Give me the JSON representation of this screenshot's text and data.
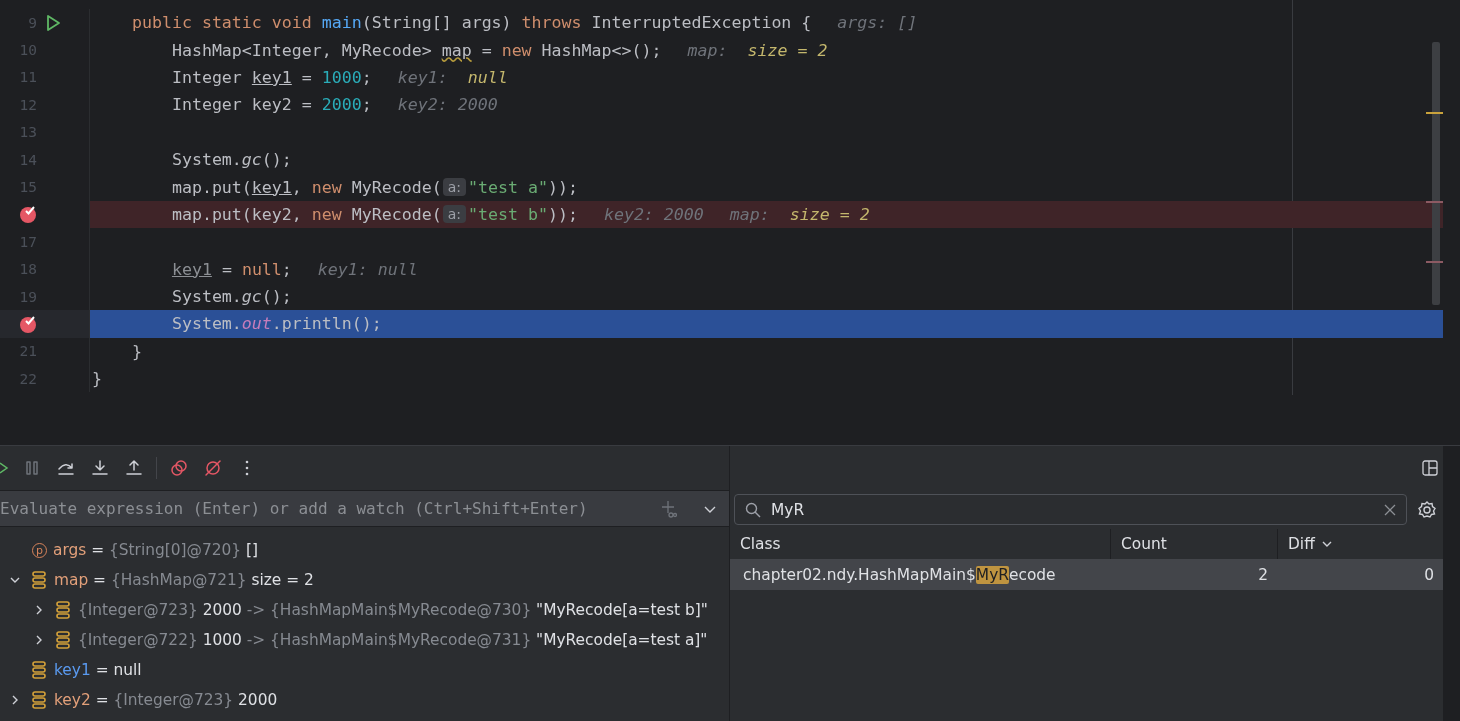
{
  "editor": {
    "lines": [
      {
        "number": "9",
        "runnable": true,
        "breakpoint": false,
        "current": false,
        "segments": [
          {
            "kind": "code",
            "tokens": [
              {
                "t": "    public static void ",
                "kind": "kw"
              },
              {
                "t": "main",
                "kind": "fn"
              },
              {
                "t": "(String[] args) ",
                "kind": "plain"
              },
              {
                "t": "throws",
                "kind": "kw"
              },
              {
                "t": " InterruptedException {",
                "kind": "plain"
              }
            ]
          },
          {
            "kind": "inline",
            "label": "args:",
            "value": "[]",
            "highlighted": false
          }
        ]
      },
      {
        "number": "10",
        "runnable": false,
        "breakpoint": false,
        "current": false,
        "segments": [
          {
            "kind": "code",
            "tokens": [
              {
                "t": "        HashMap<Integer, MyRecode> ",
                "kind": "plain"
              },
              {
                "t": "map",
                "kind": "warn"
              },
              {
                "t": " = ",
                "kind": "plain"
              },
              {
                "t": "new",
                "kind": "kw"
              },
              {
                "t": " HashMap<>();",
                "kind": "plain"
              }
            ]
          },
          {
            "kind": "inline",
            "label": "map:",
            "value": "size = 2",
            "highlighted": true
          }
        ]
      },
      {
        "number": "11",
        "runnable": false,
        "breakpoint": false,
        "current": false,
        "segments": [
          {
            "kind": "code",
            "tokens": [
              {
                "t": "        Integer ",
                "kind": "plain"
              },
              {
                "t": "key1",
                "kind": "var"
              },
              {
                "t": " = ",
                "kind": "plain"
              },
              {
                "t": "1000",
                "kind": "num"
              },
              {
                "t": ";",
                "kind": "plain"
              }
            ]
          },
          {
            "kind": "inline",
            "label": "key1:",
            "value": "null",
            "highlighted": true
          }
        ]
      },
      {
        "number": "12",
        "runnable": false,
        "breakpoint": false,
        "current": false,
        "segments": [
          {
            "kind": "code",
            "tokens": [
              {
                "t": "        Integer key2 = ",
                "kind": "plain"
              },
              {
                "t": "2000",
                "kind": "num"
              },
              {
                "t": ";",
                "kind": "plain"
              }
            ]
          },
          {
            "kind": "inline",
            "label": "key2:",
            "value": "2000",
            "highlighted": false
          }
        ]
      },
      {
        "number": "13",
        "runnable": false,
        "breakpoint": false,
        "current": false
      },
      {
        "number": "14",
        "runnable": false,
        "breakpoint": false,
        "current": false,
        "segments": [
          {
            "kind": "code",
            "tokens": [
              {
                "t": "        System.",
                "kind": "plain"
              },
              {
                "t": "gc",
                "kind": "italic"
              },
              {
                "t": "();",
                "kind": "plain"
              }
            ]
          }
        ]
      },
      {
        "number": "15",
        "runnable": false,
        "breakpoint": false,
        "current": false,
        "segments": [
          {
            "kind": "code",
            "tokens": [
              {
                "t": "        map.put(",
                "kind": "plain"
              },
              {
                "t": "key1",
                "kind": "var"
              },
              {
                "t": ", ",
                "kind": "plain"
              },
              {
                "t": "new",
                "kind": "kw"
              },
              {
                "t": " MyRecode(",
                "kind": "plain"
              }
            ]
          },
          {
            "kind": "hint",
            "text": "a:"
          },
          {
            "kind": "code",
            "tokens": [
              {
                "t": "\"test a\"",
                "kind": "str"
              },
              {
                "t": "));",
                "kind": "plain"
              }
            ]
          }
        ]
      },
      {
        "runnable": false,
        "breakpoint": true,
        "current": false,
        "segments": [
          {
            "kind": "code",
            "tokens": [
              {
                "t": "        map.put(key2, ",
                "kind": "plain"
              },
              {
                "t": "new",
                "kind": "kw"
              },
              {
                "t": " MyRecode(",
                "kind": "plain"
              }
            ]
          },
          {
            "kind": "hint",
            "text": "a:"
          },
          {
            "kind": "code",
            "tokens": [
              {
                "t": "\"test b\"",
                "kind": "str"
              },
              {
                "t": "));",
                "kind": "plain"
              }
            ]
          },
          {
            "kind": "inline",
            "label": "key2:",
            "value": "2000",
            "highlighted": false
          },
          {
            "kind": "inline",
            "label": "map:",
            "value": "size = 2",
            "highlighted": true
          }
        ]
      },
      {
        "number": "17",
        "runnable": false,
        "breakpoint": false,
        "current": false
      },
      {
        "number": "18",
        "runnable": false,
        "breakpoint": false,
        "current": false,
        "segments": [
          {
            "kind": "code",
            "tokens": [
              {
                "t": "        key1",
                "kind": "unused"
              },
              {
                "t": " = ",
                "kind": "plain"
              },
              {
                "t": "null",
                "kind": "kw"
              },
              {
                "t": ";",
                "kind": "plain"
              }
            ]
          },
          {
            "kind": "inline",
            "label": "key1:",
            "value": "null",
            "highlighted": false
          }
        ]
      },
      {
        "number": "19",
        "runnable": false,
        "breakpoint": false,
        "current": false,
        "segments": [
          {
            "kind": "code",
            "tokens": [
              {
                "t": "        System.",
                "kind": "plain"
              },
              {
                "t": "gc",
                "kind": "italic"
              },
              {
                "t": "();",
                "kind": "plain"
              }
            ]
          }
        ]
      },
      {
        "runnable": false,
        "breakpoint": true,
        "current": true,
        "segments": [
          {
            "kind": "code",
            "tokens": [
              {
                "t": "        System.",
                "kind": "plain"
              },
              {
                "t": "out",
                "kind": "field"
              },
              {
                "t": ".println();",
                "kind": "plain"
              }
            ]
          }
        ]
      },
      {
        "number": "21",
        "runnable": false,
        "breakpoint": false,
        "current": false,
        "segments": [
          {
            "kind": "code",
            "tokens": [
              {
                "t": "    }",
                "kind": "plain"
              }
            ]
          }
        ]
      },
      {
        "number": "22",
        "runnable": false,
        "breakpoint": false,
        "current": false,
        "segments": [
          {
            "kind": "code",
            "tokens": [
              {
                "t": "}",
                "kind": "plain"
              }
            ]
          }
        ]
      }
    ]
  },
  "evaluate": {
    "placeholder": "Evaluate expression (Enter) or add a watch (Ctrl+Shift+Enter)"
  },
  "variables": [
    {
      "kind": "param",
      "badge": "p",
      "parts": [
        {
          "t": "args",
          "kind": "name"
        },
        {
          "t": "=",
          "kind": "op"
        },
        {
          "t": "{String[0]@720}",
          "kind": "type"
        },
        {
          "t": "[]",
          "kind": "value"
        }
      ]
    },
    {
      "kind": "field",
      "expanded": true,
      "parts": [
        {
          "t": "map",
          "kind": "name"
        },
        {
          "t": "=",
          "kind": "op"
        },
        {
          "t": "{HashMap@721}",
          "kind": "type"
        },
        {
          "t": " size = 2",
          "kind": "value"
        }
      ],
      "children": [
        {
          "kind": "field",
          "expanded": false,
          "parts": [
            {
              "t": "{Integer@723}",
              "kind": "type"
            },
            {
              "t": "2000",
              "kind": "value"
            },
            {
              "t": "->",
              "kind": "type"
            },
            {
              "t": "{HashMapMain$MyRecode@730}",
              "kind": "type"
            },
            {
              "t": "\"MyRecode[a=test b]\"",
              "kind": "value"
            }
          ]
        },
        {
          "kind": "field",
          "expanded": false,
          "parts": [
            {
              "t": "{Integer@722}",
              "kind": "type"
            },
            {
              "t": "1000",
              "kind": "value"
            },
            {
              "t": "->",
              "kind": "type"
            },
            {
              "t": "{HashMapMain$MyRecode@731}",
              "kind": "type"
            },
            {
              "t": "\"MyRecode[a=test a]\"",
              "kind": "value"
            }
          ]
        }
      ]
    },
    {
      "kind": "field",
      "parts": [
        {
          "t": "key1",
          "kind": "changed"
        },
        {
          "t": "=",
          "kind": "op"
        },
        {
          "t": "null",
          "kind": "value"
        }
      ]
    },
    {
      "kind": "field",
      "expanded": false,
      "parts": [
        {
          "t": "key2",
          "kind": "name"
        },
        {
          "t": "=",
          "kind": "op"
        },
        {
          "t": "{Integer@723}",
          "kind": "type"
        },
        {
          "t": "2000",
          "kind": "value"
        }
      ]
    }
  ],
  "memory": {
    "search": {
      "value": "MyR"
    },
    "columns": [
      {
        "label": "Class",
        "sorted": false
      },
      {
        "label": "Count",
        "sorted": false
      },
      {
        "label": "Diff",
        "sorted": true
      }
    ],
    "rows": [
      {
        "class": {
          "before": "chapter02.ndy.HashMapMain$",
          "match": "MyR",
          "after": "ecode"
        },
        "count": "2",
        "diff": "0",
        "selected": true
      }
    ]
  }
}
